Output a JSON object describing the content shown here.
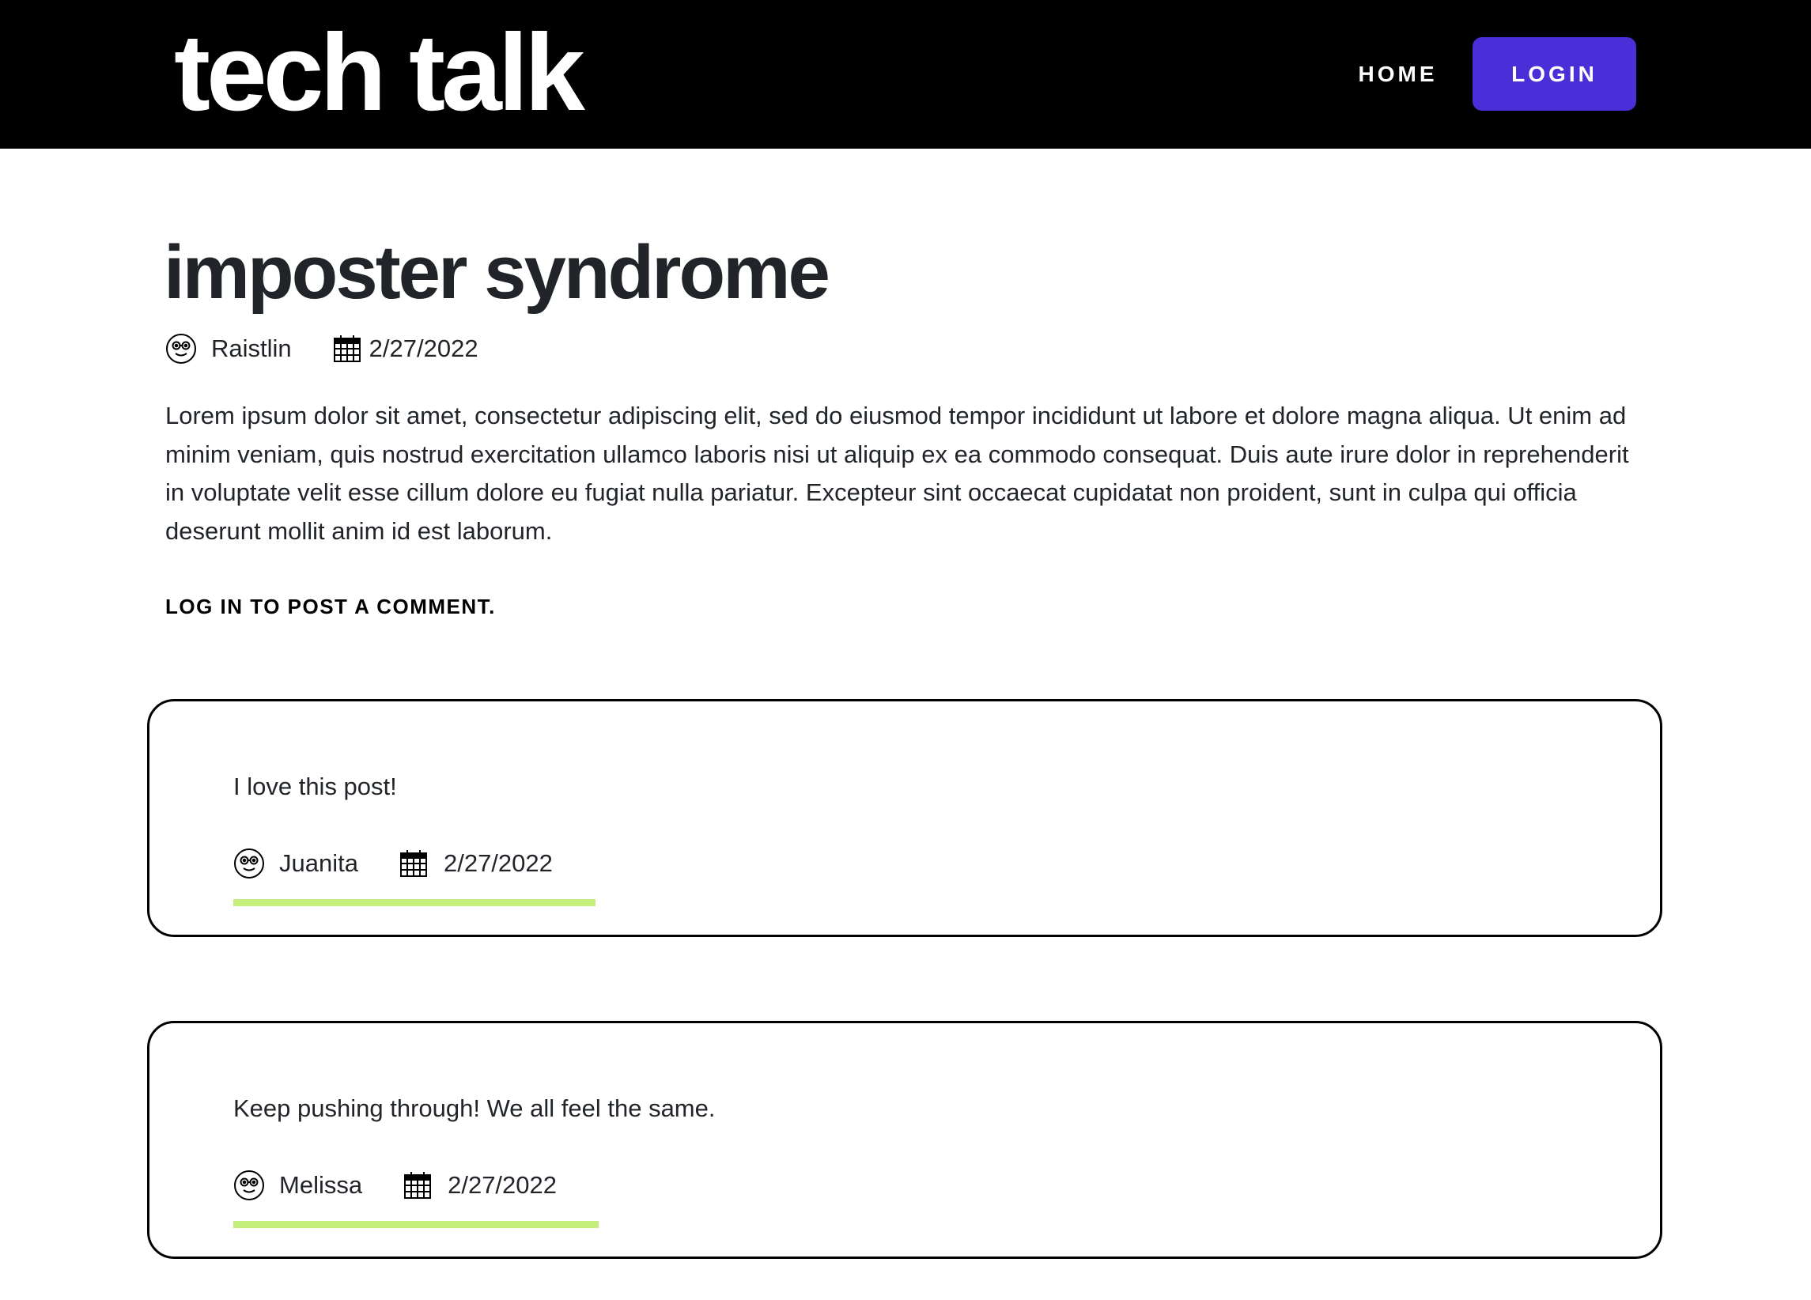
{
  "header": {
    "brand": "tech talk",
    "nav": {
      "home_label": "HOME",
      "login_label": "LOGIN"
    }
  },
  "post": {
    "title": "imposter syndrome",
    "author": "Raistlin",
    "date": "2/27/2022",
    "body": "Lorem ipsum dolor sit amet, consectetur adipiscing elit, sed do eiusmod tempor incididunt ut labore et dolore magna aliqua. Ut enim ad minim veniam, quis nostrud exercitation ullamco laboris nisi ut aliquip ex ea commodo consequat. Duis aute irure dolor in reprehenderit in voluptate velit esse cillum dolore eu fugiat nulla pariatur. Excepteur sint occaecat cupidatat non proident, sunt in culpa qui officia deserunt mollit anim id est laborum."
  },
  "comments_section": {
    "login_prompt": "LOG IN TO POST A COMMENT.",
    "comments": [
      {
        "text": "I love this post!",
        "author": "Juanita",
        "date": "2/27/2022"
      },
      {
        "text": "Keep pushing through! We all feel the same.",
        "author": "Melissa",
        "date": "2/27/2022"
      }
    ]
  },
  "icons": {
    "user": "nerd-face-icon",
    "date": "calendar-icon"
  },
  "colors": {
    "header_bg": "#000000",
    "login_button": "#4a2fd8",
    "accent_underline": "#c5ef7c",
    "text": "#212529"
  }
}
